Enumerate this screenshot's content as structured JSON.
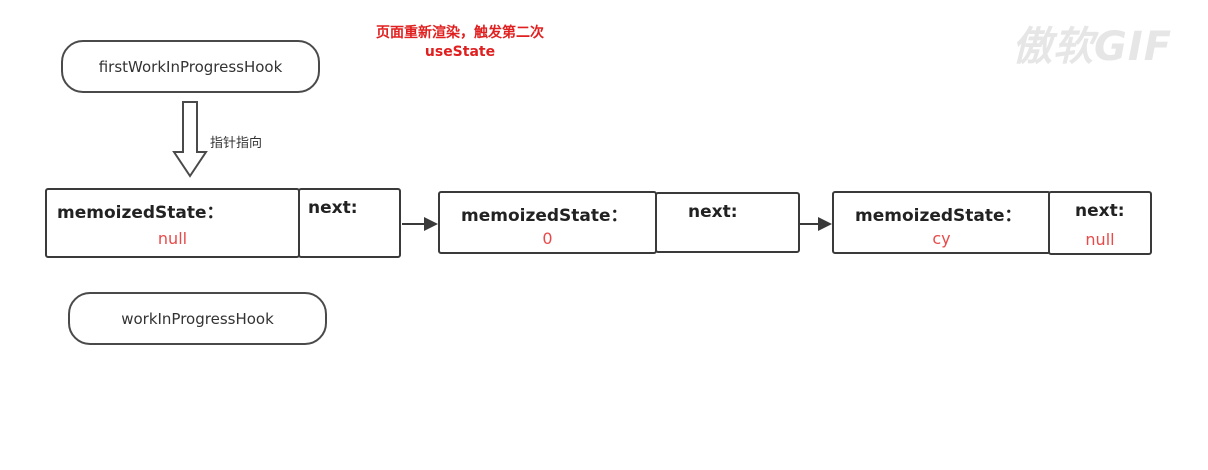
{
  "title": {
    "line1": "页面重新渲染，触发第二次",
    "line2": "useState"
  },
  "watermark": "傲软GIF",
  "pointers": {
    "first": "firstWorkInProgressHook",
    "work": "workInProgressHook",
    "arrow_label": "指针指向"
  },
  "nodes": [
    {
      "memo_label": "memoizedState：",
      "memo_value": "null",
      "next_label": "next:",
      "next_value": ""
    },
    {
      "memo_label": "memoizedState：",
      "memo_value": "0",
      "next_label": "next:",
      "next_value": ""
    },
    {
      "memo_label": "memoizedState：",
      "memo_value": "cy",
      "next_label": "next:",
      "next_value": "null"
    }
  ],
  "colors": {
    "title": "#e02020",
    "value": "#e84a4a",
    "stroke": "#3a3a3a"
  }
}
